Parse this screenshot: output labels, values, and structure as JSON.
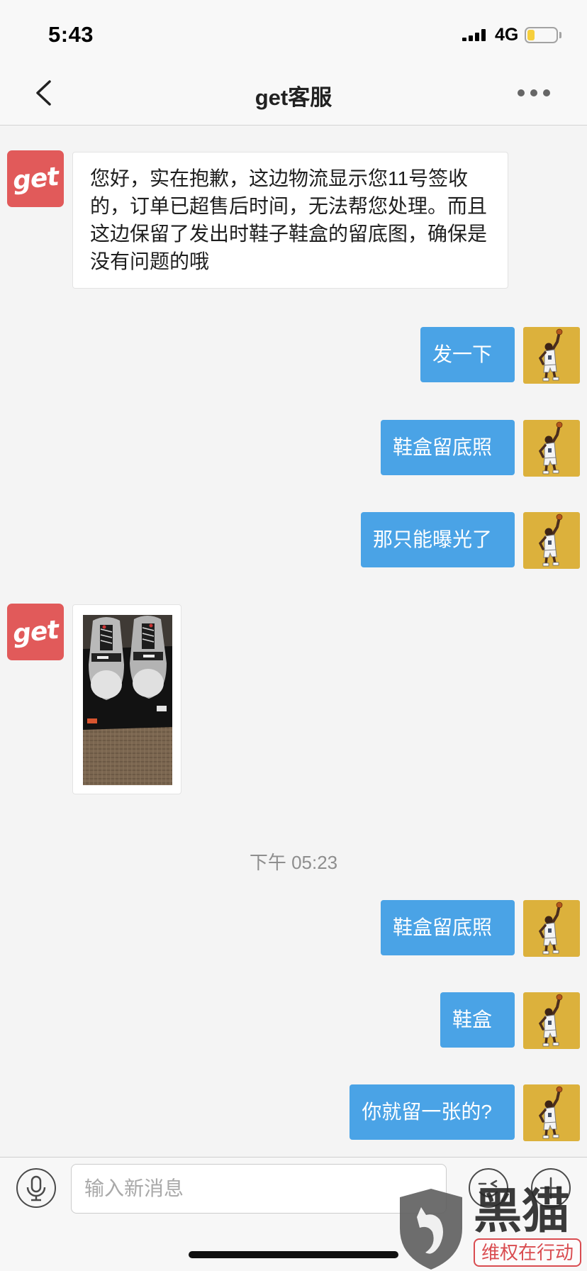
{
  "status_bar": {
    "time": "5:43",
    "network": "4G",
    "signal_bars": 4,
    "battery_level": 0.25
  },
  "nav": {
    "title": "get客服",
    "back_icon": "chevron-left-icon",
    "more_icon": "more-dots-icon"
  },
  "chat": {
    "incoming_text_message": {
      "avatar": "get",
      "text": "您好，实在抱歉，这边物流显示您11号签收的，订单已超售后时间，无法帮您处理。而且这边保留了发出时鞋子鞋盒的留底图，确保是没有问题的哦"
    },
    "outgoing_group_1": [
      "发一下",
      "鞋盒留底照",
      "那只能曝光了"
    ],
    "incoming_image_message": {
      "avatar": "get"
    },
    "timestamp": "下午 05:23",
    "outgoing_group_2": [
      "鞋盒留底照",
      "鞋盒",
      "你就留一张的?"
    ],
    "user_avatar_icon": "basketball-player-icon"
  },
  "input_bar": {
    "placeholder": "输入新消息",
    "voice_icon": "microphone-icon",
    "emoji_icon": "emoji-icon",
    "add_icon": "plus-icon"
  },
  "watermark": {
    "brand": "黑猫",
    "slogan": "维权在行动"
  },
  "colors": {
    "outgoing_bubble": "#4aa3e6",
    "brand_avatar": "#e15a5a",
    "user_avatar_bg": "#dcb13c",
    "battery_fill": "#f6cf3c"
  }
}
